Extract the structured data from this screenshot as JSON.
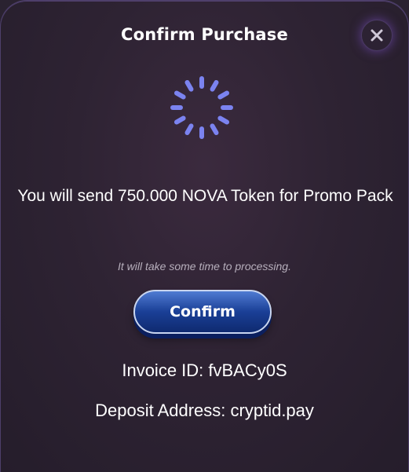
{
  "modal": {
    "title": "Confirm Purchase",
    "close_icon": "close-icon",
    "spinner_icon": "loading-spinner-icon",
    "message": "You will send 750.000 NOVA Token for Promo Pack",
    "subnote": "It will take some time to processing.",
    "confirm_label": "Confirm",
    "invoice_text": "Invoice ID: fvBACy0S",
    "deposit_text": "Deposit Address: cryptid.pay"
  },
  "colors": {
    "background": "#2a2230",
    "accent": "#7b83f0",
    "button": "#1a3f96"
  }
}
